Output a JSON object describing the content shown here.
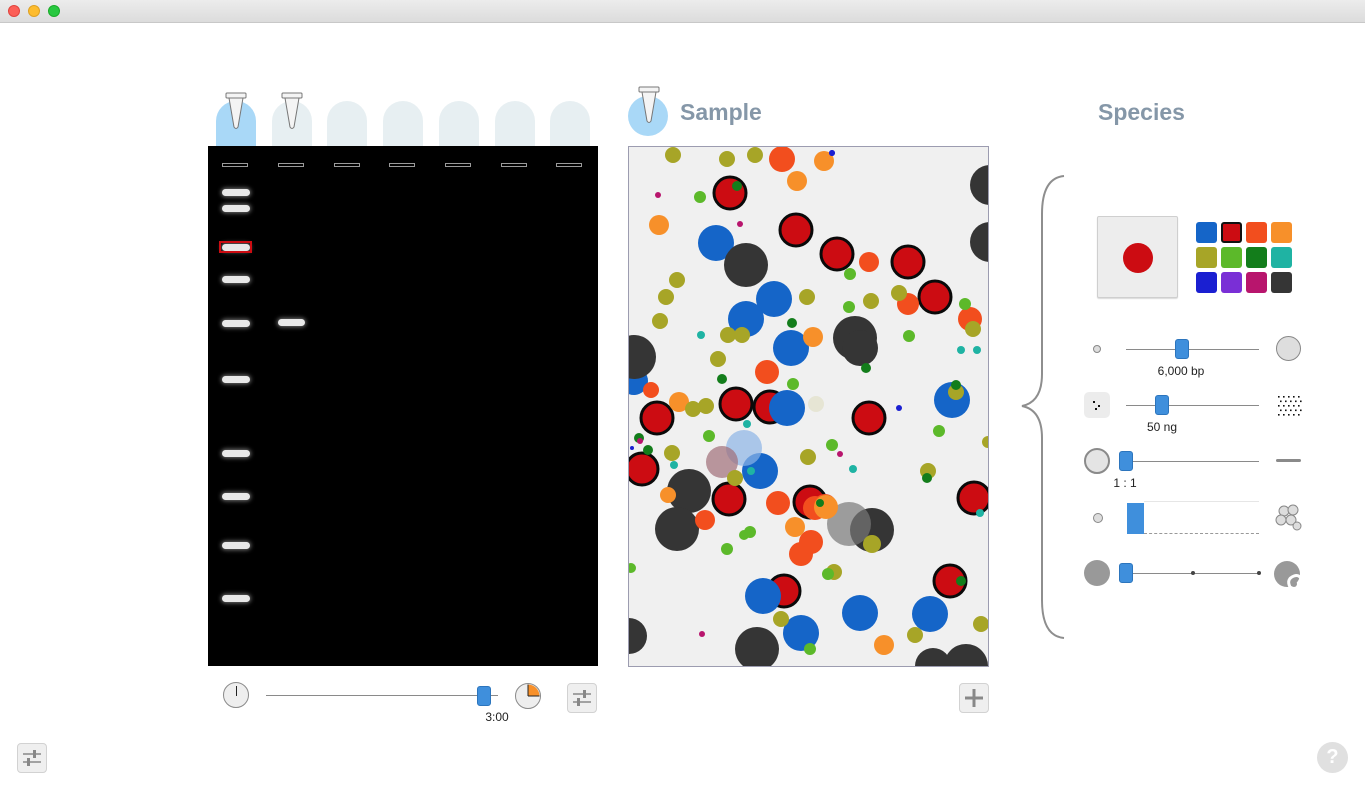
{
  "window": {
    "title": ""
  },
  "gel": {
    "lanes": [
      {
        "type": "ladder",
        "active": true
      },
      {
        "type": "sample",
        "active": false
      },
      {
        "type": "empty"
      },
      {
        "type": "empty"
      },
      {
        "type": "empty"
      },
      {
        "type": "empty"
      },
      {
        "type": "empty"
      }
    ]
  },
  "sample": {
    "heading": "Sample"
  },
  "species": {
    "heading": "Species",
    "selected_color": "#cc0c12",
    "palette": [
      "#1565c8",
      "#cc0c12",
      "#f24e1e",
      "#f7902a",
      "#a7a527",
      "#5cb92a",
      "#137d1b",
      "#1fb3a3",
      "#1a1fd1",
      "#7a2fd6",
      "#b8156d",
      "#353535"
    ],
    "size_label": "6,000 bp",
    "amount_label": "50 ng",
    "ratio_label": "1 : 1",
    "size_level": 0.42,
    "amount_level": 0.27,
    "ratio_level": 0.0,
    "shape_level": 0.0
  },
  "timer": {
    "label": "3:00",
    "level": 0.94
  },
  "colors": {
    "gel": "#000000",
    "accent": "#3f8fdc",
    "tube": "#a9d8f7",
    "heading": "#8597a8"
  },
  "icons": {
    "ladder_tube": "tube-icon",
    "settings": "sliders-icon",
    "add": "plus-icon",
    "help": "question-icon"
  },
  "help_label": "?"
}
